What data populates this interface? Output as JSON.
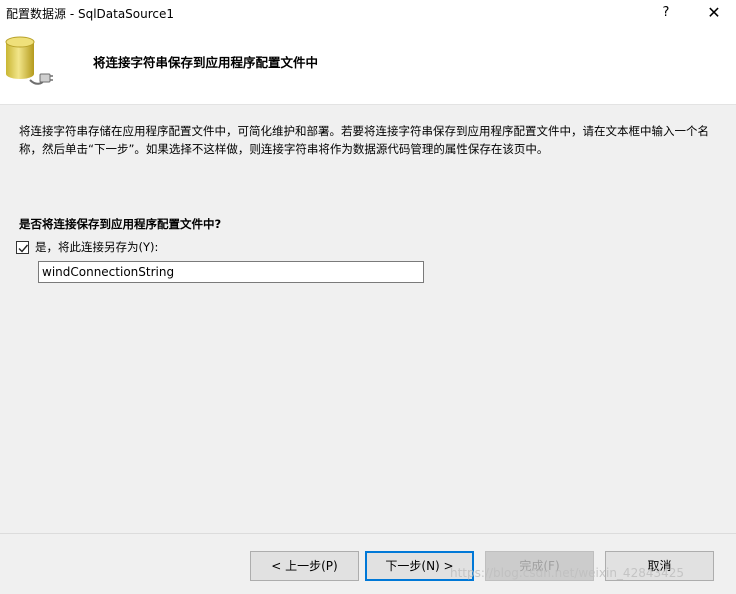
{
  "window": {
    "title": "配置数据源 - SqlDataSource1",
    "help_label": "?",
    "close_label": "✕"
  },
  "header": {
    "title": "将连接字符串保存到应用程序配置文件中",
    "icon": "database-plug-icon"
  },
  "body": {
    "description": "将连接字符串存储在应用程序配置文件中，可简化维护和部署。若要将连接字符串保存到应用程序配置文件中，请在文本框中输入一个名称，然后单击“下一步”。如果选择不这样做，则连接字符串将作为数据源代码管理的属性保存在该页中。",
    "question": "是否将连接保存到应用程序配置文件中?",
    "save_checkbox": {
      "label": "是，将此连接另存为(Y):",
      "checked": true
    },
    "connection_name": {
      "value": "windConnectionString"
    }
  },
  "footer": {
    "prev_label": "< 上一步(P)",
    "next_label": "下一步(N) >",
    "finish_label": "完成(F)",
    "cancel_label": "取消"
  },
  "watermark": "https://blog.csdn.net/weixin_42843425",
  "colors": {
    "accent": "#0078d7",
    "header_bg": "#ffffff",
    "body_bg": "#f0f0f0"
  }
}
